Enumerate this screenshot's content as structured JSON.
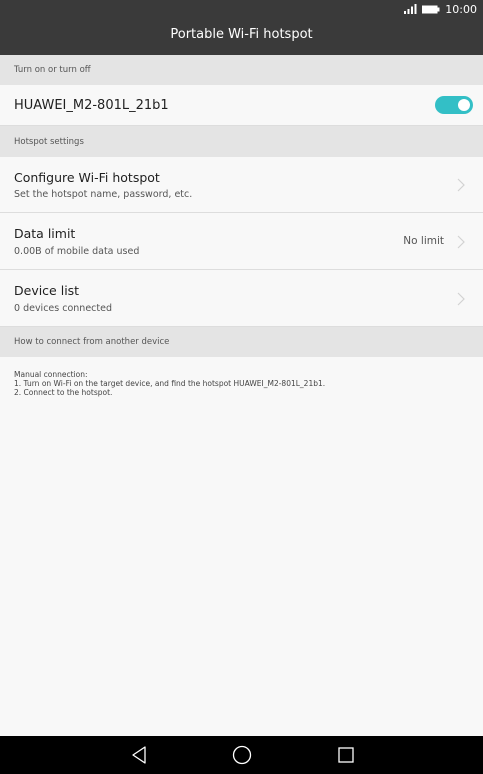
{
  "status_bar": {
    "time": "10:00",
    "signal_icon": "signal-icon",
    "battery_icon": "battery-icon"
  },
  "header": {
    "title": "Portable Wi-Fi hotspot"
  },
  "sections": {
    "turn_on_off": "Turn on or turn off",
    "hotspot_settings": "Hotspot settings",
    "how_to_connect": "How to connect from another device"
  },
  "hotspot_row": {
    "name": "HUAWEI_M2-801L_21b1",
    "toggle_on": true
  },
  "settings": [
    {
      "title": "Configure Wi-Fi hotspot",
      "subtitle": "Set the hotspot name, password, etc.",
      "value": ""
    },
    {
      "title": "Data limit",
      "subtitle": "0.00B of mobile data used",
      "value": "No limit"
    },
    {
      "title": "Device list",
      "subtitle": "0 devices connected",
      "value": ""
    }
  ],
  "instructions": {
    "line1": "Manual connection:",
    "line2": "1. Turn on Wi-Fi on the target device, and find the hotspot HUAWEI_M2-801L_21b1.",
    "line3": "2. Connect to the hotspot."
  },
  "colors": {
    "header_bg": "#3a3a3a",
    "accent": "#33bfc6",
    "section_bg": "#e4e4e4",
    "navbar_bg": "#000000"
  },
  "navbar": {
    "back_icon": "back-icon",
    "home_icon": "home-icon",
    "recents_icon": "recents-icon"
  }
}
